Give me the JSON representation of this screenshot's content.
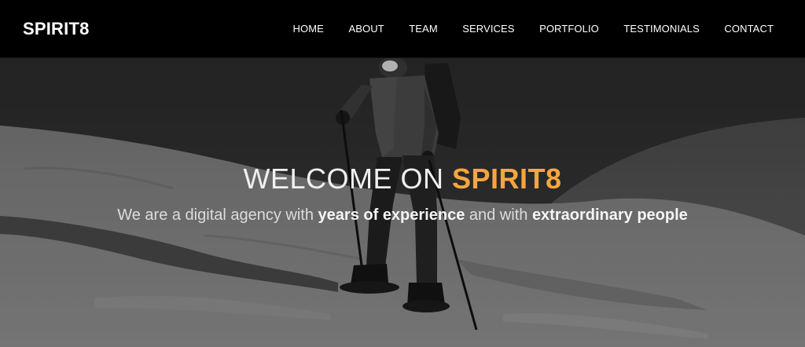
{
  "navbar": {
    "brand": "SPIRIT8",
    "links": [
      {
        "label": "HOME"
      },
      {
        "label": "ABOUT"
      },
      {
        "label": "TEAM"
      },
      {
        "label": "SERVICES"
      },
      {
        "label": "PORTFOLIO"
      },
      {
        "label": "TESTIMONIALS"
      },
      {
        "label": "CONTACT"
      }
    ]
  },
  "hero": {
    "title_prefix": "WELCOME ON ",
    "title_accent": "SPIRIT8",
    "subtitle": {
      "part1": "We are a digital agency with ",
      "bold1": "years of experience",
      "part2": " and with ",
      "bold2": "extraordinary people"
    },
    "background_image": "snowshoe-hiker-photo"
  },
  "colors": {
    "accent": "#f7a540",
    "navbar_bg": "#000000",
    "text_light": "#f0f0f0"
  }
}
